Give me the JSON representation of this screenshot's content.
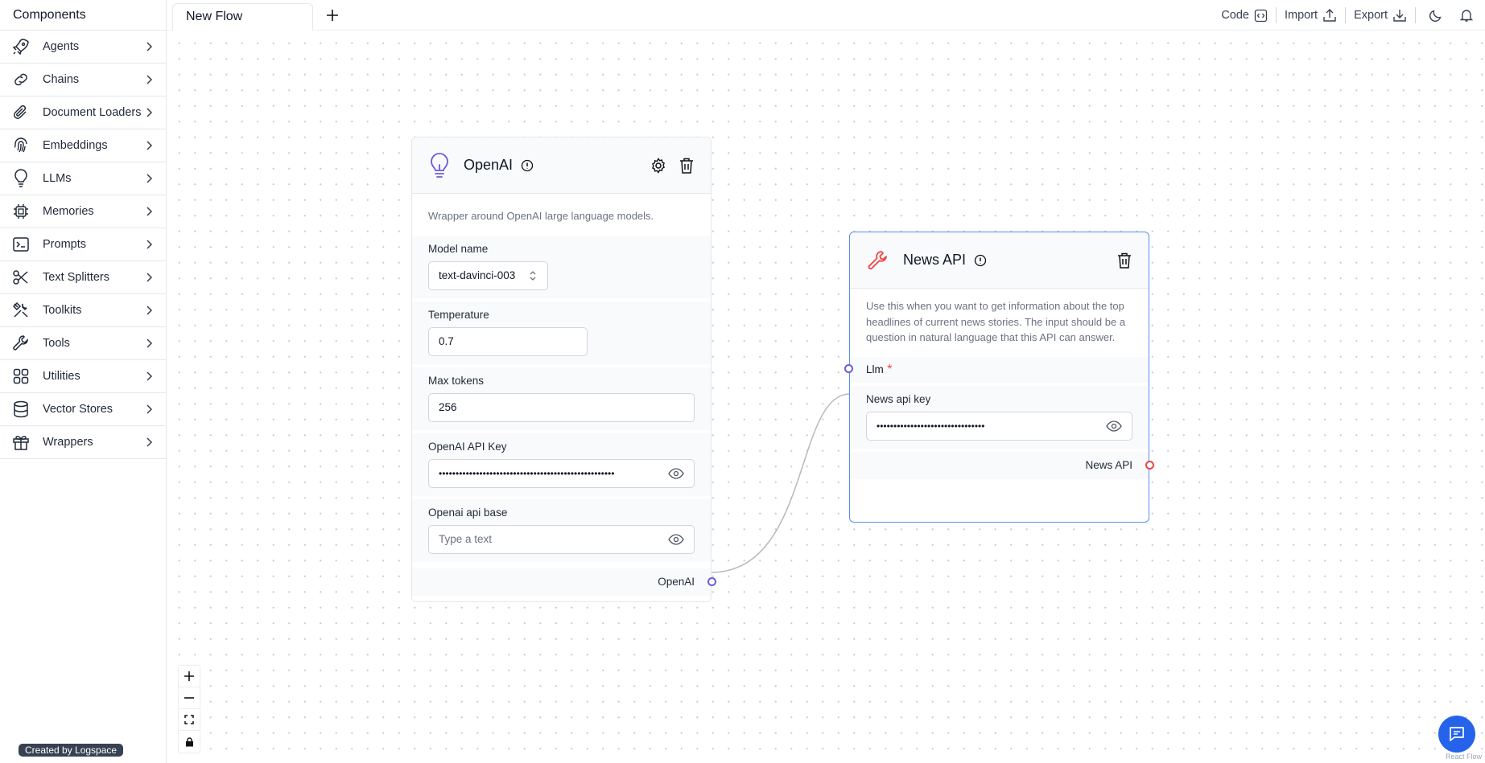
{
  "sidebar": {
    "title": "Components",
    "items": [
      {
        "label": "Agents",
        "icon": "rocket-icon"
      },
      {
        "label": "Chains",
        "icon": "link-icon"
      },
      {
        "label": "Document Loaders",
        "icon": "paperclip-icon"
      },
      {
        "label": "Embeddings",
        "icon": "fingerprint-icon"
      },
      {
        "label": "LLMs",
        "icon": "lightbulb-icon"
      },
      {
        "label": "Memories",
        "icon": "cpu-icon"
      },
      {
        "label": "Prompts",
        "icon": "terminal-icon"
      },
      {
        "label": "Text Splitters",
        "icon": "scissors-icon"
      },
      {
        "label": "Toolkits",
        "icon": "tools-icon"
      },
      {
        "label": "Tools",
        "icon": "wrench-icon"
      },
      {
        "label": "Utilities",
        "icon": "grid-icon"
      },
      {
        "label": "Vector Stores",
        "icon": "database-icon"
      },
      {
        "label": "Wrappers",
        "icon": "gift-icon"
      }
    ],
    "credit": "Created by Logspace"
  },
  "topbar": {
    "tab_label": "New Flow",
    "code_label": "Code",
    "import_label": "Import",
    "export_label": "Export"
  },
  "openai_node": {
    "title": "OpenAI",
    "description": "Wrapper around OpenAI large language models.",
    "model_name_label": "Model name",
    "model_name_value": "text-davinci-003",
    "temperature_label": "Temperature",
    "temperature_value": "0.7",
    "max_tokens_label": "Max tokens",
    "max_tokens_value": "256",
    "api_key_label": "OpenAI API Key",
    "api_key_value": "••••••••••••••••••••••••••••••••••••••••••••••••••••",
    "api_base_label": "Openai api base",
    "api_base_placeholder": "Type a text",
    "output_label": "OpenAI",
    "accent": "#6b5cd6"
  },
  "news_node": {
    "title": "News API",
    "description": "Use this when you want to get information about the top headlines of current news stories. The input should be a question in natural language that this API can answer.",
    "llm_label": "Llm",
    "required_mark": "*",
    "api_key_label": "News api key",
    "api_key_value": "••••••••••••••••••••••••••••••••",
    "output_label": "News API",
    "accent": "#ef4444"
  },
  "footer": {
    "react_flow": "React Flow"
  }
}
